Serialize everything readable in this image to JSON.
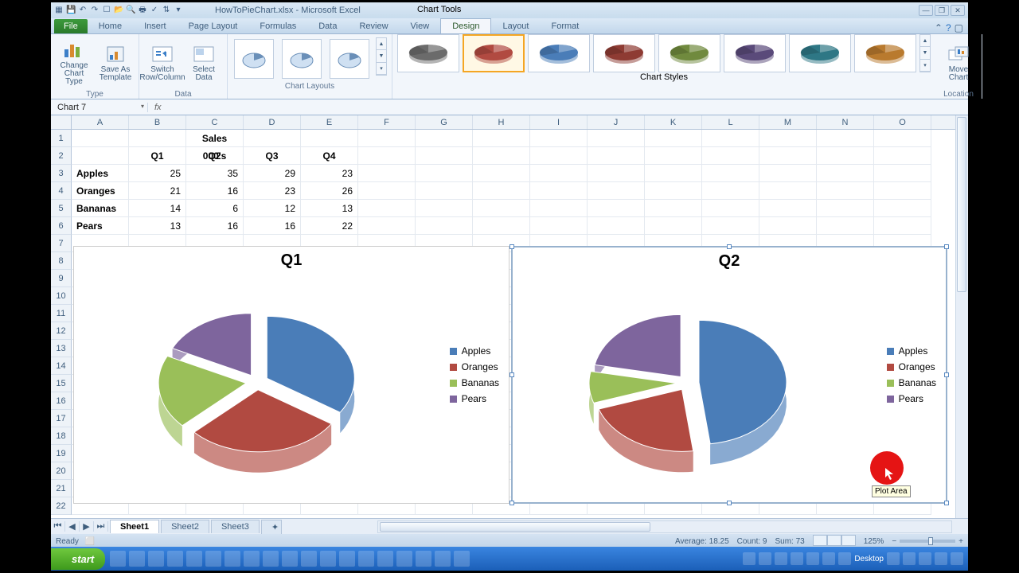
{
  "title": {
    "filename": "HowToPieChart.xlsx",
    "app": "Microsoft Excel",
    "context": "Chart Tools"
  },
  "tabs": {
    "file": "File",
    "list": [
      "Home",
      "Insert",
      "Page Layout",
      "Formulas",
      "Data",
      "Review",
      "View",
      "Design",
      "Layout",
      "Format"
    ],
    "active": "Design"
  },
  "ribbon": {
    "type_group": "Type",
    "change_type": "Change Chart Type",
    "save_tpl": "Save As Template",
    "data_group": "Data",
    "switch_rc": "Switch Row/Column",
    "select_data": "Select Data",
    "layouts_group": "Chart Layouts",
    "styles_group": "Chart Styles",
    "location_group": "Location",
    "move_chart": "Move Chart"
  },
  "namebox": "Chart 7",
  "fx_symbol": "fx",
  "columns": [
    "A",
    "B",
    "C",
    "D",
    "E",
    "F",
    "G",
    "H",
    "I",
    "J",
    "K",
    "L",
    "M",
    "N",
    "O"
  ],
  "rows": [
    "1",
    "2",
    "3",
    "4",
    "5",
    "6",
    "7",
    "8",
    "9",
    "10",
    "11",
    "12",
    "13",
    "14",
    "15",
    "16",
    "17",
    "18",
    "19",
    "20",
    "21",
    "22"
  ],
  "sheet": {
    "c1": "Sales 000's",
    "q": [
      "Q1",
      "Q2",
      "Q3",
      "Q4"
    ],
    "r": [
      "Apples",
      "Oranges",
      "Bananas",
      "Pears"
    ],
    "vals": [
      [
        25,
        35,
        29,
        23
      ],
      [
        21,
        16,
        23,
        26
      ],
      [
        14,
        6,
        12,
        13
      ],
      [
        13,
        16,
        16,
        22
      ]
    ]
  },
  "chart_data": [
    {
      "type": "pie",
      "title": "Q1",
      "series": "Q1",
      "categories": [
        "Apples",
        "Oranges",
        "Bananas",
        "Pears"
      ],
      "values": [
        25,
        21,
        14,
        13
      ],
      "colors": [
        "#4a7db8",
        "#b14a41",
        "#9abf59",
        "#7e659d"
      ]
    },
    {
      "type": "pie",
      "title": "Q2",
      "series": "Q2",
      "categories": [
        "Apples",
        "Oranges",
        "Bananas",
        "Pears"
      ],
      "values": [
        35,
        16,
        6,
        16
      ],
      "colors": [
        "#4a7db8",
        "#b14a41",
        "#9abf59",
        "#7e659d"
      ]
    }
  ],
  "legend_labels": [
    "Apples",
    "Oranges",
    "Bananas",
    "Pears"
  ],
  "legend_colors": [
    "#4a7db8",
    "#b14a41",
    "#9abf59",
    "#7e659d"
  ],
  "sheets": [
    "Sheet1",
    "Sheet2",
    "Sheet3"
  ],
  "status": {
    "ready": "Ready",
    "avg_l": "Average:",
    "avg": "18.25",
    "cnt_l": "Count:",
    "cnt": "9",
    "sum_l": "Sum:",
    "sum": "73",
    "zoom": "125%"
  },
  "taskbar": {
    "start": "start",
    "desktop": "Desktop"
  },
  "tooltip": "Plot Area",
  "style_colors": [
    "#6b6b6b",
    "#b14a41",
    "#4a7db8",
    "#8e3b33",
    "#708a3e",
    "#5a4a7a",
    "#2e7785",
    "#b97a2e"
  ]
}
